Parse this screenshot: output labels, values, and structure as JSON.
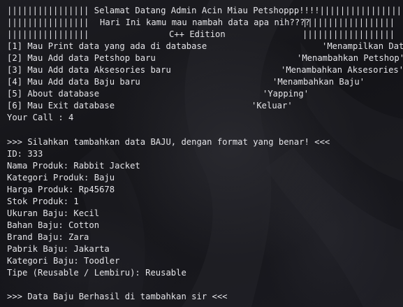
{
  "banner": {
    "line1": "|||||||||||||||| Selamat Datang Admin Acin Miau Petshoppp!!!!||||||||||||||||||",
    "line2_bars_left": "||||||||||||||||",
    "line2_text": "Hari Ini kamu mau nambah data apa nih????",
    "line2_bars_right": "||||||||||||||||||",
    "line3_bars_left": "||||||||||||||||",
    "line3_text": "C++ Edition",
    "line3_bars_right": "||||||||||||||||||"
  },
  "menu": [
    {
      "label": "[1] Mau Print data yang ada di database",
      "tag": "'Menampilkan Data'"
    },
    {
      "label": "[2] Mau Add data Petshop baru",
      "tag": "'Menambahkan Petshop'"
    },
    {
      "label": "[3] Mau Add data Aksesories baru",
      "tag": "'Menambahkan Aksesories'"
    },
    {
      "label": "[4] Mau Add data Baju baru",
      "tag": "'Menambahkan Baju'"
    },
    {
      "label": "[5] About database",
      "tag": "'Yapping'"
    },
    {
      "label": "[6] Mau Exit database",
      "tag": "'Keluar'"
    }
  ],
  "prompt": "Your Call : 4",
  "form_header": ">>> Silahkan tambahkan data BAJU, dengan format yang benar! <<<",
  "fields": [
    "ID: 333",
    "Nama Produk: Rabbit Jacket",
    "Kategori Produk: Baju",
    "Harga Produk: Rp45678",
    "Stok Produk: 1",
    "Ukuran Baju: Kecil",
    "Bahan Baju: Cotton",
    "Brand Baju: Zara",
    "Pabrik Baju: Jakarta",
    "Kategori Baju: Toodler",
    "Tipe (Reusable / Lembiru): Reusable"
  ],
  "result": ">>> Data Baju Berhasil di tambahkan sir <<<"
}
